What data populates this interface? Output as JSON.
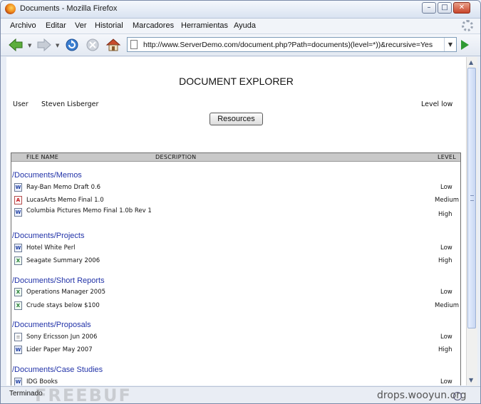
{
  "window": {
    "title": "Documents - Mozilla Firefox",
    "minimize_glyph": "–",
    "maximize_glyph": "□",
    "close_glyph": "✕"
  },
  "menu": [
    "Archivo",
    "Editar",
    "Ver",
    "Historial",
    "Marcadores",
    "Herramientas",
    "Ayuda"
  ],
  "nav": {
    "url": "http://www.ServerDemo.com/document.php?Path=documents)(level=*))&recursive=Yes",
    "icons": [
      "back-arrow-icon",
      "forward-arrow-icon",
      "reload-icon",
      "stop-icon",
      "home-icon",
      "go-arrow-icon"
    ]
  },
  "page": {
    "title": "DOCUMENT EXPLORER",
    "user_label": "User",
    "user_name": "Steven Lisberger",
    "level": "Level low",
    "resources_label": "Resources"
  },
  "table": {
    "headers": [
      "FILE NAME",
      "DESCRIPTION",
      "LEVEL"
    ],
    "groups": [
      {
        "folder": "/Documents/Memos",
        "files": [
          {
            "name": "Ray-Ban Memo Draft 0.6",
            "level": "Low",
            "icon": "word"
          },
          {
            "name": "LucasArts Memo Final 1.0",
            "level": "Medium",
            "icon": "pdf"
          },
          {
            "name": "Columbia Pictures Memo Final 1.0b Rev 1",
            "level": "High",
            "icon": "word"
          }
        ]
      },
      {
        "folder": "/Documents/Projects",
        "files": [
          {
            "name": "Hotel White Perl",
            "level": "Low",
            "icon": "word"
          },
          {
            "name": "Seagate Summary 2006",
            "level": "High",
            "icon": "excel"
          }
        ]
      },
      {
        "folder": "/Documents/Short Reports",
        "files": [
          {
            "name": "Operations Manager 2005",
            "level": "Low",
            "icon": "excel"
          },
          {
            "name": "Crude stays below $100",
            "level": "Medium",
            "icon": "excel"
          }
        ]
      },
      {
        "folder": "/Documents/Proposals",
        "files": [
          {
            "name": "Sony Ericsson Jun 2006",
            "level": "Low",
            "icon": "text"
          },
          {
            "name": "Lider Paper May 2007",
            "level": "High",
            "icon": "word"
          }
        ]
      },
      {
        "folder": "/Documents/Case Studies",
        "files": [
          {
            "name": "IDG Books",
            "level": "Low",
            "icon": "word"
          }
        ]
      }
    ]
  },
  "status": {
    "text": "Terminado",
    "watermark_left": "FREEBUF",
    "watermark_right": "drops.wooyun.org"
  },
  "colors": {
    "folder_link": "#2233a8",
    "table_header_bg": "#c9c9c9",
    "go_button": "#2f9a33"
  }
}
